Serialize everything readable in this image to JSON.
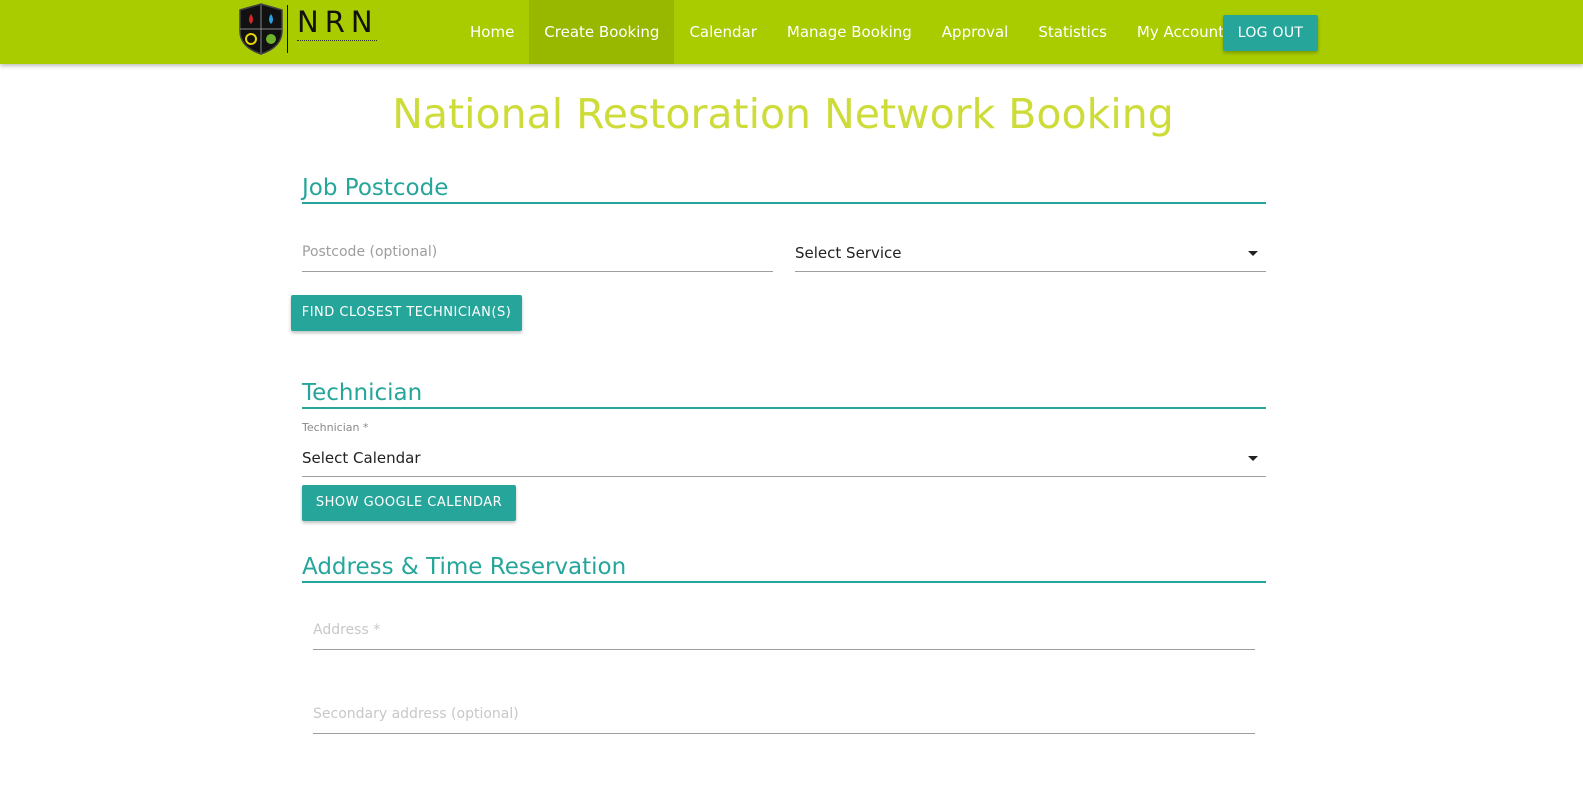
{
  "brand": {
    "logo_text": "NRN"
  },
  "nav": {
    "items": [
      {
        "label": "Home"
      },
      {
        "label": "Create Booking"
      },
      {
        "label": "Calendar"
      },
      {
        "label": "Manage Booking"
      },
      {
        "label": "Approval"
      },
      {
        "label": "Statistics"
      },
      {
        "label": "My Account"
      }
    ],
    "active": "Create Booking",
    "logout_label": "LOG OUT"
  },
  "page": {
    "title": "National Restoration Network Booking"
  },
  "job_postcode": {
    "section_title": "Job Postcode",
    "postcode_placeholder": "Postcode (optional)",
    "service_value": "Select Service",
    "find_button": "FIND CLOSEST TECHNICIAN(S)"
  },
  "technician": {
    "section_title": "Technician",
    "field_label": "Technician *",
    "field_value": "Select Calendar",
    "calendar_button": "SHOW GOOGLE CALENDAR"
  },
  "address": {
    "section_title": "Address & Time Reservation",
    "address_placeholder": "Address *",
    "secondary_placeholder": "Secondary address (optional)"
  },
  "colors": {
    "topbar": "#a8cc00",
    "active_nav": "#98b800",
    "accent": "#26a69a",
    "title": "#cddc39"
  }
}
